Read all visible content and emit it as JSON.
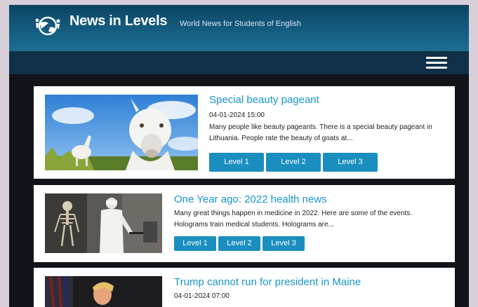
{
  "header": {
    "site_title": "News in Levels",
    "tagline": "World News for Students of English",
    "logo_icon": "globe-people-icon",
    "menu_icon": "hamburger-menu-icon",
    "colors": {
      "header": "#145d80",
      "navbar": "#0f3047",
      "accent": "#1a8ebf",
      "link": "#1a95c9"
    }
  },
  "articles": [
    {
      "title": "Special beauty pageant",
      "date": "04-01-2024 15:00",
      "excerpt": "Many people like beauty pageants. There is a special beauty pageant in Lithuania. People rate the beauty of goats at...",
      "levels": [
        "Level 1",
        "Level 2",
        "Level 3"
      ]
    },
    {
      "title": "One Year ago: 2022 health news",
      "excerpt": "Many great things happen in medicine in 2022. Here are some of the events. Holograms train medical students. Holograms are...",
      "levels": [
        "Level 1",
        "Level 2",
        "Level 3"
      ]
    },
    {
      "title": "Trump cannot run for president in Maine",
      "date": "04-01-2024 07:00"
    }
  ]
}
